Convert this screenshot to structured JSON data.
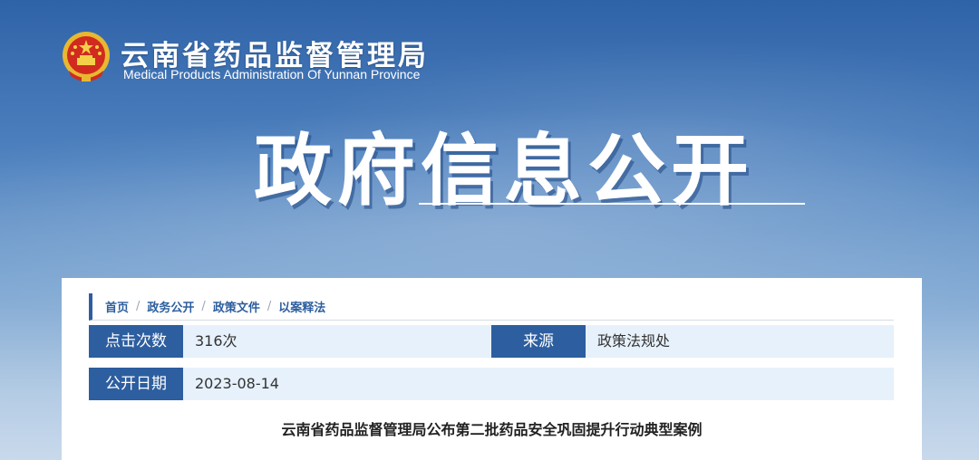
{
  "header": {
    "org_name_cn": "云南省药品监督管理局",
    "org_name_en": "Medical Products Administration Of Yunnan Province",
    "banner_title": "政府信息公开"
  },
  "breadcrumb": [
    {
      "label": "首页"
    },
    {
      "label": "政务公开"
    },
    {
      "label": "政策文件"
    },
    {
      "label": "以案释法"
    }
  ],
  "meta": {
    "clicks_label": "点击次数",
    "clicks_value": "316次",
    "source_label": "来源",
    "source_value": "政策法规处",
    "date_label": "公开日期",
    "date_value": "2023-08-14"
  },
  "article": {
    "title": "云南省药品监督管理局公布第二批药品安全巩固提升行动典型案例"
  },
  "colors": {
    "brand_blue": "#2d5e9f",
    "value_bg": "#e6f1fb"
  }
}
